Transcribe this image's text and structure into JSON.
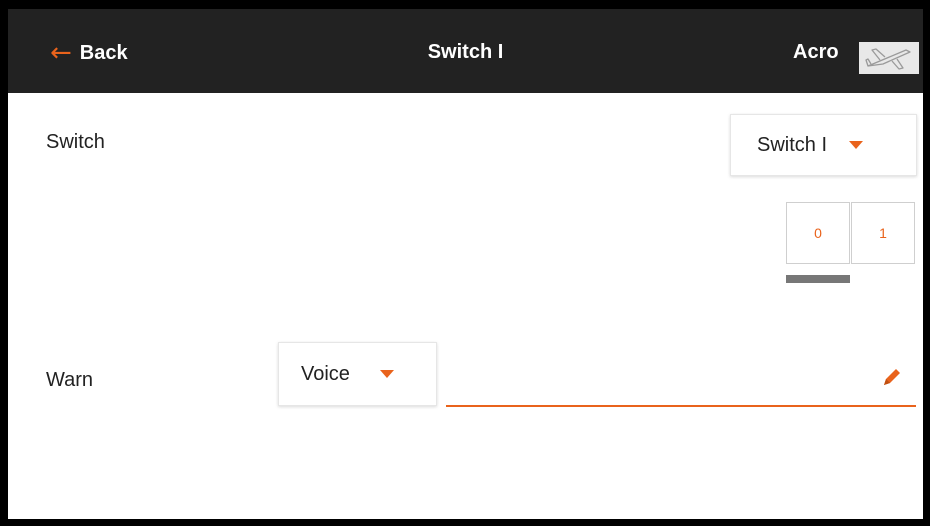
{
  "header": {
    "back_label": "Back",
    "title": "Switch I",
    "mode": "Acro",
    "model_icon": "airplane-icon"
  },
  "switch_row": {
    "label": "Switch",
    "selected": "Switch I"
  },
  "positions": [
    "0",
    "1"
  ],
  "active_position": "0",
  "warn_row": {
    "label": "Warn",
    "selected": "Voice",
    "text_value": ""
  },
  "colors": {
    "accent": "#e9631c",
    "header_bg": "#222222",
    "indicator": "#777777"
  }
}
